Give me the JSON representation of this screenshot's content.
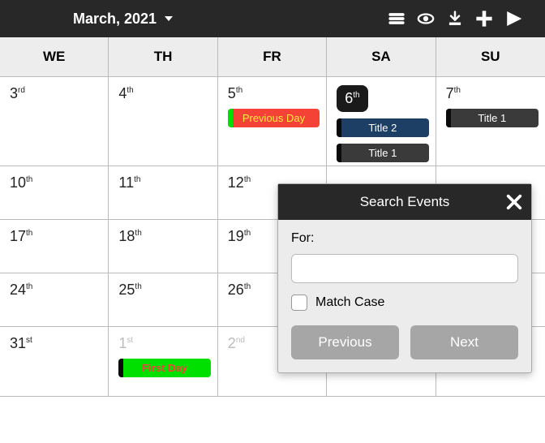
{
  "header": {
    "month_label": "March, 2021"
  },
  "days_header": [
    "WE",
    "TH",
    "FR",
    "SA",
    "SU"
  ],
  "weeks": [
    {
      "cells": [
        {
          "num": "3",
          "ord": "rd"
        },
        {
          "num": "4",
          "ord": "th"
        },
        {
          "num": "5",
          "ord": "th",
          "events": [
            {
              "cls": "red",
              "label": "Previous Day"
            }
          ]
        },
        {
          "num": "6",
          "ord": "th",
          "today": true,
          "events": [
            {
              "cls": "navy",
              "label": "Title 2"
            },
            {
              "cls": "dark",
              "label": "Title 1"
            }
          ]
        },
        {
          "num": "7",
          "ord": "th",
          "events": [
            {
              "cls": "dark",
              "label": "Title 1"
            }
          ]
        }
      ]
    },
    {
      "short": true,
      "cells": [
        {
          "num": "10",
          "ord": "th"
        },
        {
          "num": "11",
          "ord": "th"
        },
        {
          "num": "12",
          "ord": "th"
        },
        {
          "num": "",
          "ord": ""
        },
        {
          "num": "",
          "ord": ""
        }
      ]
    },
    {
      "short": true,
      "cells": [
        {
          "num": "17",
          "ord": "th"
        },
        {
          "num": "18",
          "ord": "th"
        },
        {
          "num": "19",
          "ord": "th"
        },
        {
          "num": "",
          "ord": ""
        },
        {
          "num": "",
          "ord": ""
        }
      ]
    },
    {
      "short": true,
      "cells": [
        {
          "num": "24",
          "ord": "th"
        },
        {
          "num": "25",
          "ord": "th"
        },
        {
          "num": "26",
          "ord": "th"
        },
        {
          "num": "",
          "ord": ""
        },
        {
          "num": "",
          "ord": ""
        }
      ]
    },
    {
      "cells": [
        {
          "num": "31",
          "ord": "st"
        },
        {
          "num": "1",
          "ord": "st",
          "muted": true,
          "events": [
            {
              "cls": "green",
              "label": "First Day"
            }
          ]
        },
        {
          "num": "2",
          "ord": "nd",
          "muted": true
        },
        {
          "num": "",
          "ord": ""
        },
        {
          "num": "",
          "ord": ""
        }
      ]
    }
  ],
  "popup": {
    "title": "Search Events",
    "for_label": "For:",
    "input_value": "",
    "match_case_label": "Match Case",
    "previous_label": "Previous",
    "next_label": "Next"
  }
}
